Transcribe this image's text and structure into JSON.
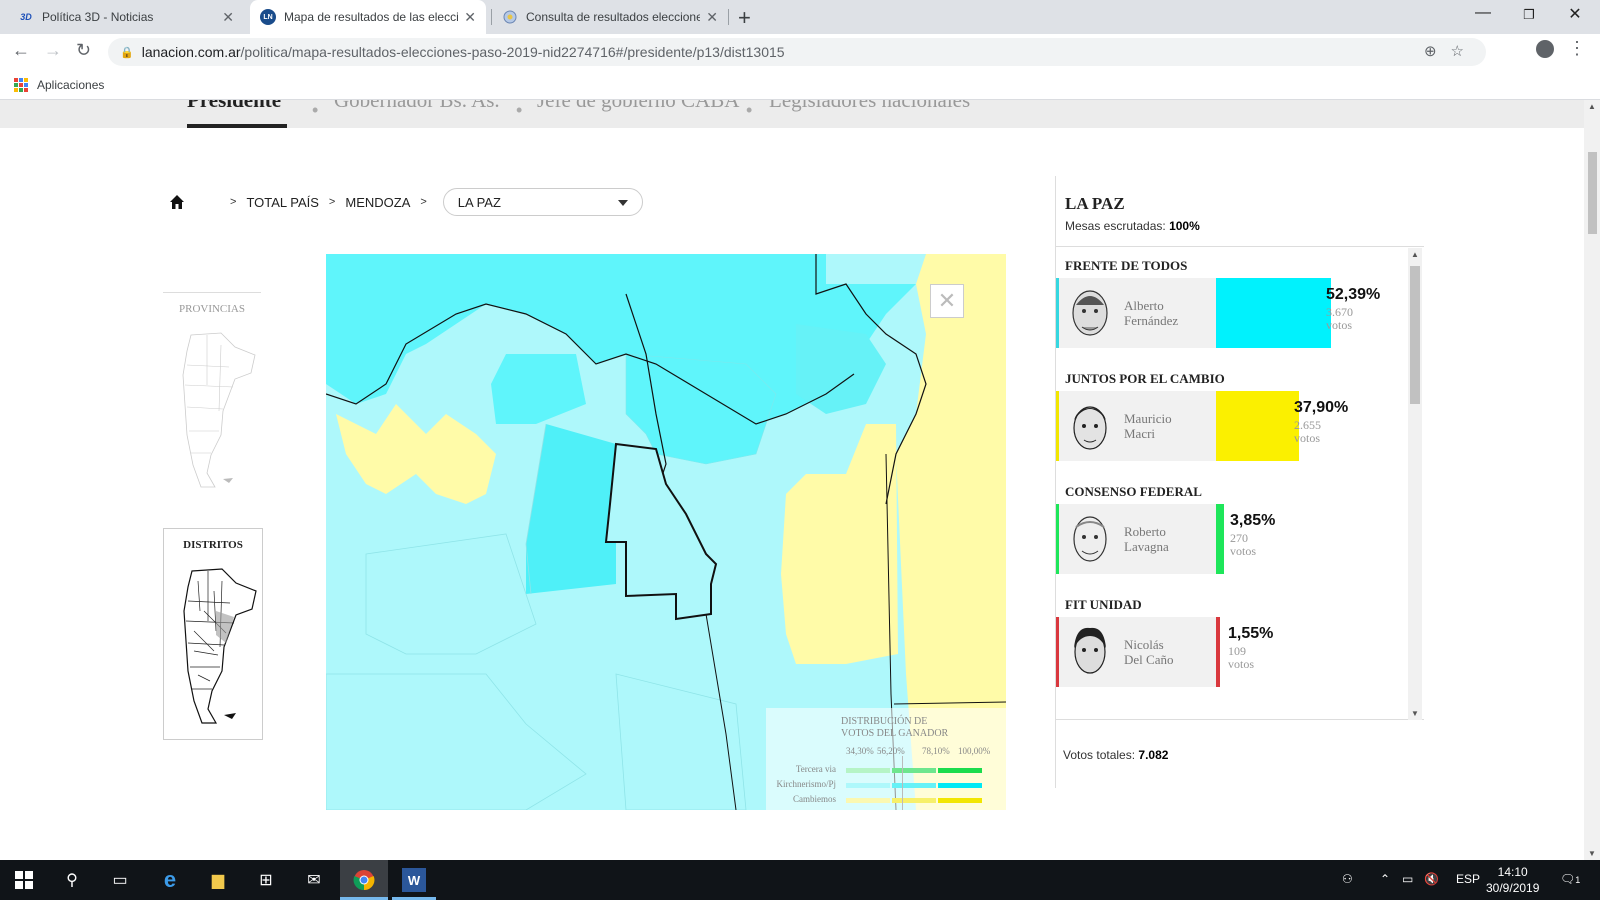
{
  "browser": {
    "tabs": [
      {
        "title": "Política 3D - Noticias",
        "favicon": "3D"
      },
      {
        "title": "Mapa de resultados de las elecci",
        "favicon": "LN"
      },
      {
        "title": "Consulta de resultados eleccione",
        "favicon": "seal"
      }
    ],
    "url_host": "lanacion.com.ar",
    "url_path": "/politica/mapa-resultados-elecciones-paso-2019-nid2274716#/presidente/p13/dist13015",
    "bookmark": "Aplicaciones"
  },
  "subnav": {
    "items": [
      "Presidente",
      "Gobernador Bs. As.",
      "Jefe de gobierno CABA",
      "Legisladores nacionales"
    ]
  },
  "breadcrumb": {
    "total": "TOTAL PAÍS",
    "province": "MENDOZA",
    "district": "LA PAZ",
    "sep": ">"
  },
  "mini_maps": {
    "provincias": "PROVINCIAS",
    "distritos": "DISTRITOS"
  },
  "legend": {
    "title_line1": "DISTRIBUCIÓN DE",
    "title_line2": "VOTOS DEL GANADOR",
    "ticks": [
      "34,30%",
      "56,20%",
      "78,10%",
      "100,00%"
    ],
    "rows": [
      {
        "label": "Tercera via",
        "colors": [
          "#b6f4c6",
          "#6ee68e",
          "#1bdc4d"
        ]
      },
      {
        "label": "Kirchnerismo/Pj",
        "colors": [
          "#aef8fb",
          "#66f2f7",
          "#00e9f4"
        ]
      },
      {
        "label": "Cambiemos",
        "colors": [
          "#fbf8b1",
          "#f7f06a",
          "#f2e600"
        ]
      }
    ]
  },
  "results": {
    "district": "LA PAZ",
    "mesas_label": "Mesas escrutadas:",
    "mesas_value": "100%",
    "candidates": [
      {
        "party": "FRENTE DE TODOS",
        "name_l1": "Alberto",
        "name_l2": "Fernández",
        "pct": "52,39%",
        "votes": "3.670",
        "votes_label": "votos",
        "share": 52.39,
        "color": "#00f2fd",
        "accent": "#36d7e0"
      },
      {
        "party": "JUNTOS POR EL CAMBIO",
        "name_l1": "Mauricio",
        "name_l2": "Macri",
        "pct": "37,90%",
        "votes": "2.655",
        "votes_label": "votos",
        "share": 37.9,
        "color": "#fbf000",
        "accent": "#f2e600"
      },
      {
        "party": "CONSENSO FEDERAL",
        "name_l1": "Roberto",
        "name_l2": "Lavagna",
        "pct": "3,85%",
        "votes": "270",
        "votes_label": "votos",
        "share": 3.85,
        "color": "#1ee65a",
        "accent": "#1ee65a"
      },
      {
        "party": "FIT UNIDAD",
        "name_l1": "Nicolás",
        "name_l2": "Del Caño",
        "pct": "1,55%",
        "votes": "109",
        "votes_label": "votos",
        "share": 1.55,
        "color": "#d9383e",
        "accent": "#d9383e"
      }
    ],
    "total_label": "Votos totales:",
    "total_value": "7.082"
  },
  "taskbar": {
    "time": "14:10",
    "date": "30/9/2019",
    "lang": "ESP",
    "notif_count": "1"
  },
  "colors": {
    "kirchner_light": "#aef8fb",
    "kirchner_mid": "#5ff5fb",
    "cambiemos_light": "#fffba8"
  }
}
